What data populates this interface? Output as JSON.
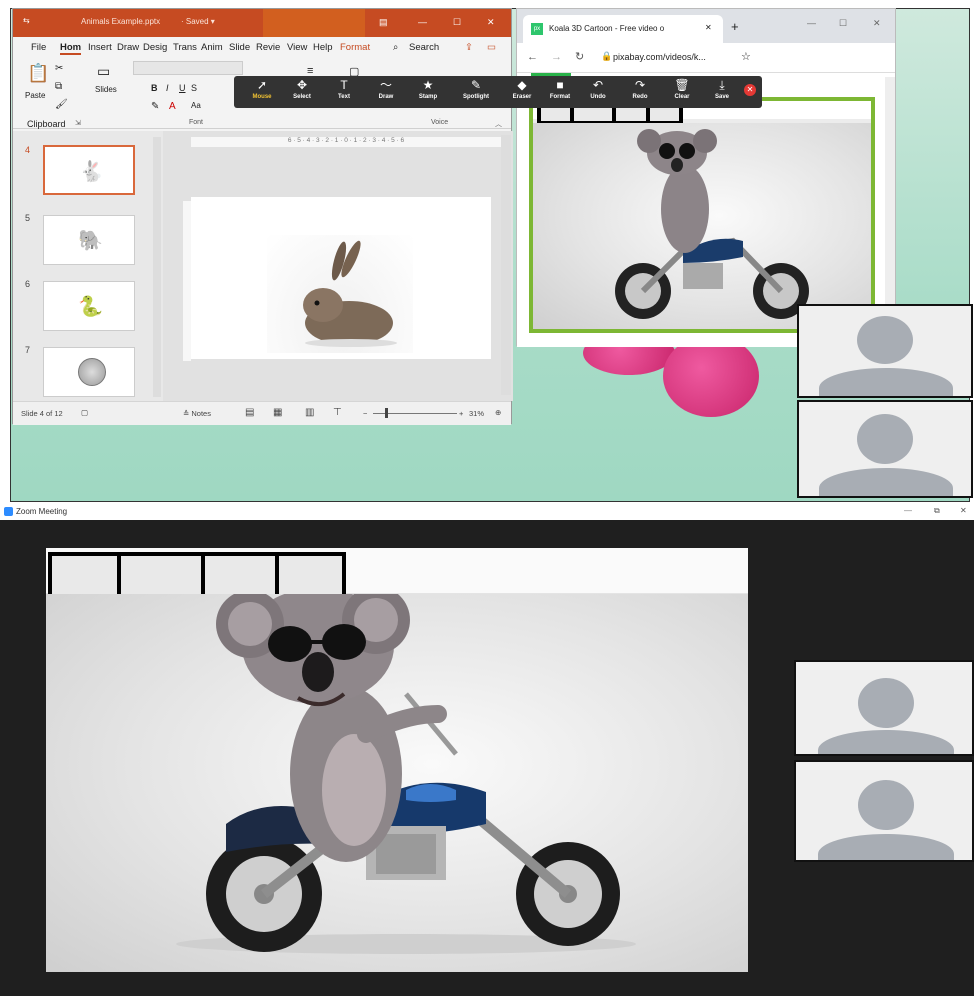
{
  "powerpoint": {
    "title": "Animals Example.pptx",
    "saved_status": "· Saved ▾",
    "menu": [
      "File",
      "Hom",
      "Insert",
      "Draw",
      "Desig",
      "Trans",
      "Anim",
      "Slide",
      "Revie",
      "View",
      "Help",
      "Format"
    ],
    "search_label": "Search",
    "ribbon": {
      "paste_label": "Paste",
      "slides_label": "Slides",
      "font_size_text": "Aa",
      "group_clipboard": "Clipboard",
      "group_font": "Font",
      "group_voice": "Voice"
    },
    "slides": [
      {
        "number": "4",
        "icon": "rabbit-icon",
        "selected": true
      },
      {
        "number": "5",
        "icon": "elephant-icon"
      },
      {
        "number": "6",
        "icon": "snake-icon"
      },
      {
        "number": "7",
        "icon": "coin-icon"
      }
    ],
    "ruler": "6 · 5 · 4 · 3 · 2 · 1 · 0 · 1 · 2 · 3 · 4 · 5 · 6",
    "status": {
      "slide_info": "Slide 4 of 12",
      "notes_label": "≙ Notes",
      "zoom": "31%"
    }
  },
  "annotation_toolbar": {
    "tools": [
      {
        "label": "Mouse",
        "icon": "➚",
        "active": true
      },
      {
        "label": "Select",
        "icon": "✥"
      },
      {
        "label": "Text",
        "icon": "T"
      },
      {
        "label": "Draw",
        "icon": "〜"
      },
      {
        "label": "Stamp",
        "icon": "★"
      },
      {
        "label": "Spotlight",
        "icon": "✎"
      },
      {
        "label": "Eraser",
        "icon": "◆"
      },
      {
        "label": "Format",
        "icon": "■"
      },
      {
        "label": "Undo",
        "icon": "↶"
      },
      {
        "label": "Redo",
        "icon": "↷"
      },
      {
        "label": "Clear",
        "icon": "🗑"
      },
      {
        "label": "Save",
        "icon": "⤓"
      }
    ]
  },
  "chrome": {
    "tab_title": "Koala 3D Cartoon - Free video o",
    "tab_favicon": "px",
    "url": "pixabay.com/videos/k..."
  },
  "zoom": {
    "window_title": "Zoom Meeting"
  },
  "colors": {
    "ppt_accent": "#c64b22",
    "pixabay_green": "#7db734",
    "toolbar_bg": "#333333",
    "zoom_bg": "#1f1f1f"
  }
}
